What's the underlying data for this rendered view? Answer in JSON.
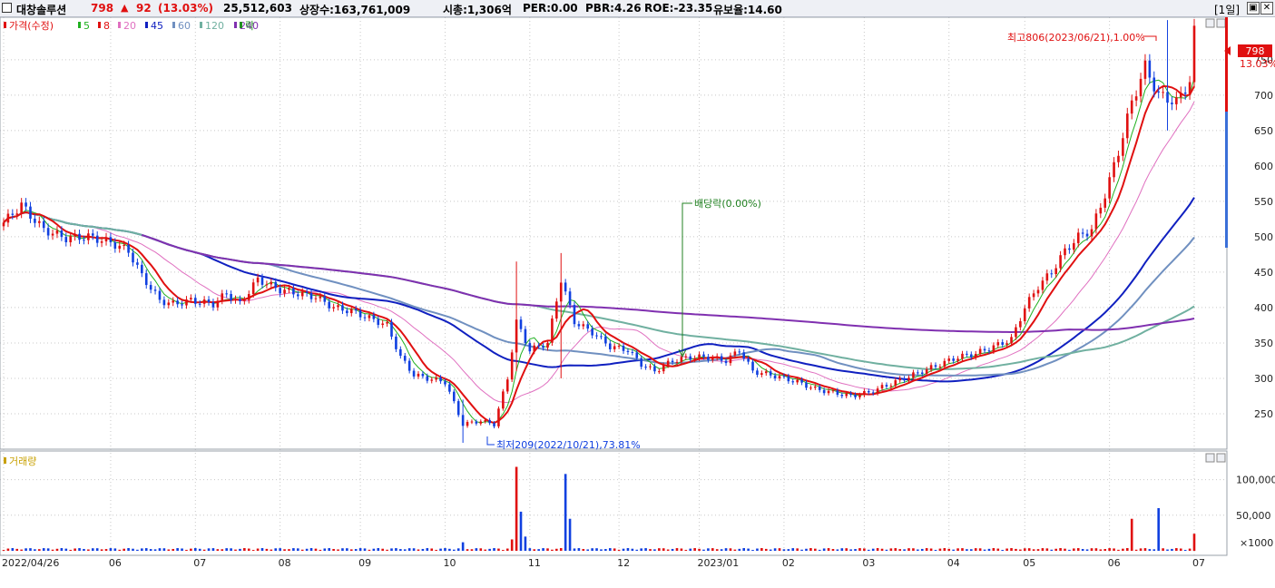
{
  "header": {
    "name": "대창솔루션",
    "price": "798",
    "arrow": "▲",
    "change": "92",
    "change_pct": "(13.03%)",
    "volume": "25,512,603",
    "shares": "상장수:163,761,009",
    "mcap": "시총:1,306억",
    "per": "PER:0.00",
    "pbr": "PBR:4.26",
    "roe": "ROE:-23.35",
    "float": "유보율:14.60",
    "period": "[1일]"
  },
  "legend": {
    "price": "가격(수정)",
    "ma": [
      {
        "label": "5",
        "color": "#20b020"
      },
      {
        "label": "8",
        "color": "#e01010"
      },
      {
        "label": "20",
        "color": "#e070c0"
      },
      {
        "label": "45",
        "color": "#1020c0"
      },
      {
        "label": "60",
        "color": "#7090c0"
      },
      {
        "label": "120",
        "color": "#70b0a0"
      },
      {
        "label": "240",
        "color": "#8030b0"
      }
    ],
    "ex": "락",
    "volume": "거래량"
  },
  "annotations": {
    "high": "최고806(2023/06/21),1.00%",
    "low": "최저209(2022/10/21),73.81%",
    "dividend": "배당락(0.00%)",
    "last_price": "798",
    "last_pct": "13.03%",
    "vol_unit": "×1000"
  },
  "colors": {
    "up": "#e01010",
    "down": "#1040e0",
    "grid": "#c8c8c8"
  },
  "chart_data": {
    "type": "candlestick",
    "x_ticks": [
      "2022/04/26",
      "06",
      "07",
      "08",
      "09",
      "10",
      "11",
      "12",
      "2023/01",
      "02",
      "03",
      "04",
      "05",
      "06",
      "07"
    ],
    "price_ticks": [
      250,
      300,
      350,
      400,
      450,
      500,
      550,
      600,
      650,
      700,
      750
    ],
    "volume_ticks": [
      "100,000",
      "50,000"
    ],
    "price_range": [
      200,
      810
    ],
    "volume_range_k": [
      0,
      125000
    ],
    "last_price": 798,
    "high": {
      "value": 806,
      "date": "2023/06/21"
    },
    "low": {
      "value": 209,
      "date": "2022/10/21"
    },
    "close_anchors": [
      [
        0,
        520
      ],
      [
        4,
        545
      ],
      [
        6,
        530
      ],
      [
        9,
        510
      ],
      [
        14,
        498
      ],
      [
        19,
        500
      ],
      [
        24,
        492
      ],
      [
        28,
        480
      ],
      [
        31,
        445
      ],
      [
        35,
        410
      ],
      [
        38,
        405
      ],
      [
        42,
        410
      ],
      [
        47,
        405
      ],
      [
        50,
        420
      ],
      [
        53,
        405
      ],
      [
        57,
        440
      ],
      [
        62,
        425
      ],
      [
        66,
        420
      ],
      [
        70,
        415
      ],
      [
        74,
        400
      ],
      [
        78,
        395
      ],
      [
        82,
        385
      ],
      [
        86,
        375
      ],
      [
        89,
        330
      ],
      [
        92,
        305
      ],
      [
        95,
        300
      ],
      [
        99,
        295
      ],
      [
        103,
        235
      ],
      [
        107,
        240
      ],
      [
        110,
        235
      ],
      [
        113,
        300
      ],
      [
        115,
        380
      ],
      [
        118,
        340
      ],
      [
        122,
        350
      ],
      [
        125,
        440
      ],
      [
        128,
        380
      ],
      [
        132,
        365
      ],
      [
        136,
        345
      ],
      [
        140,
        340
      ],
      [
        143,
        320
      ],
      [
        146,
        310
      ],
      [
        150,
        325
      ],
      [
        154,
        330
      ],
      [
        158,
        330
      ],
      [
        162,
        325
      ],
      [
        165,
        340
      ],
      [
        168,
        310
      ],
      [
        172,
        305
      ],
      [
        175,
        300
      ],
      [
        178,
        295
      ],
      [
        182,
        285
      ],
      [
        186,
        280
      ],
      [
        190,
        275
      ],
      [
        194,
        280
      ],
      [
        198,
        290
      ],
      [
        202,
        300
      ],
      [
        206,
        310
      ],
      [
        210,
        320
      ],
      [
        214,
        330
      ],
      [
        218,
        335
      ],
      [
        222,
        345
      ],
      [
        226,
        355
      ],
      [
        229,
        400
      ],
      [
        232,
        430
      ],
      [
        235,
        450
      ],
      [
        238,
        480
      ],
      [
        241,
        500
      ],
      [
        244,
        510
      ],
      [
        247,
        560
      ],
      [
        250,
        620
      ],
      [
        253,
        690
      ],
      [
        256,
        740
      ],
      [
        259,
        700
      ],
      [
        263,
        690
      ],
      [
        266,
        720
      ],
      [
        267,
        798
      ]
    ],
    "wicks": {
      "103": [
        209,
        270
      ],
      "125": [
        300,
        477
      ],
      "115": [
        310,
        465
      ],
      "261": [
        650,
        806
      ]
    },
    "volume_spikes": {
      "103": 12000,
      "114": 16000,
      "115": 118000,
      "116": 55000,
      "117": 20000,
      "126": 108000,
      "127": 45000,
      "253": 45000,
      "259": 60000,
      "267": 24000
    },
    "ma_lines": [
      {
        "period": 20,
        "color": "#e070c0",
        "from": 19
      },
      {
        "period": 45,
        "color": "#1020c0",
        "from": 0
      },
      {
        "period": 60,
        "color": "#7090c0",
        "from": 0
      },
      {
        "period": 120,
        "color": "#70b0a0",
        "from": 0
      },
      {
        "period": 240,
        "color": "#8030b0",
        "from": 31
      }
    ]
  }
}
